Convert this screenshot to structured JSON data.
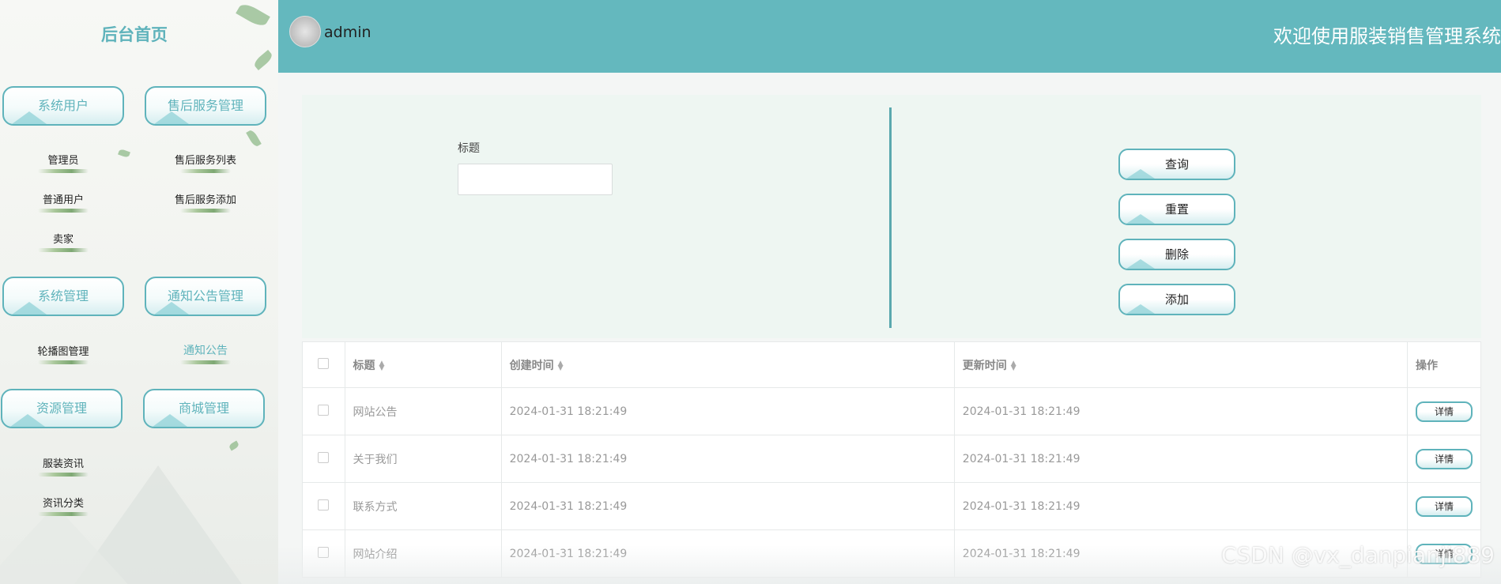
{
  "sidebar": {
    "home_title": "后台首页",
    "groups": [
      {
        "label": "系统用户",
        "items": [
          "管理员",
          "普通用户",
          "卖家"
        ]
      },
      {
        "label": "售后服务管理",
        "items": [
          "售后服务列表",
          "售后服务添加"
        ]
      },
      {
        "label": "系统管理",
        "items": [
          "轮播图管理"
        ]
      },
      {
        "label": "通知公告管理",
        "items": [
          "通知公告"
        ]
      },
      {
        "label": "资源管理",
        "items": [
          "服装资讯",
          "资讯分类"
        ]
      },
      {
        "label": "商城管理",
        "items": []
      }
    ],
    "active_item": "通知公告"
  },
  "header": {
    "username": "admin",
    "welcome": "欢迎使用服装销售管理系统"
  },
  "search": {
    "title_label": "标题",
    "title_value": "",
    "buttons": {
      "query": "查询",
      "reset": "重置",
      "delete": "删除",
      "add": "添加"
    }
  },
  "table": {
    "columns": [
      "标题",
      "创建时间",
      "更新时间",
      "操作"
    ],
    "rows": [
      {
        "title": "网站公告",
        "created": "2024-01-31 18:21:49",
        "updated": "2024-01-31 18:21:49",
        "action": "详情"
      },
      {
        "title": "关于我们",
        "created": "2024-01-31 18:21:49",
        "updated": "2024-01-31 18:21:49",
        "action": "详情"
      },
      {
        "title": "联系方式",
        "created": "2024-01-31 18:21:49",
        "updated": "2024-01-31 18:21:49",
        "action": "详情"
      },
      {
        "title": "网站介绍",
        "created": "2024-01-31 18:21:49",
        "updated": "2024-01-31 18:21:49",
        "action": "详情"
      }
    ]
  },
  "watermark": "CSDN @vx_danpianji889",
  "colors": {
    "accent": "#64b8be",
    "panel": "#eef6f2"
  }
}
